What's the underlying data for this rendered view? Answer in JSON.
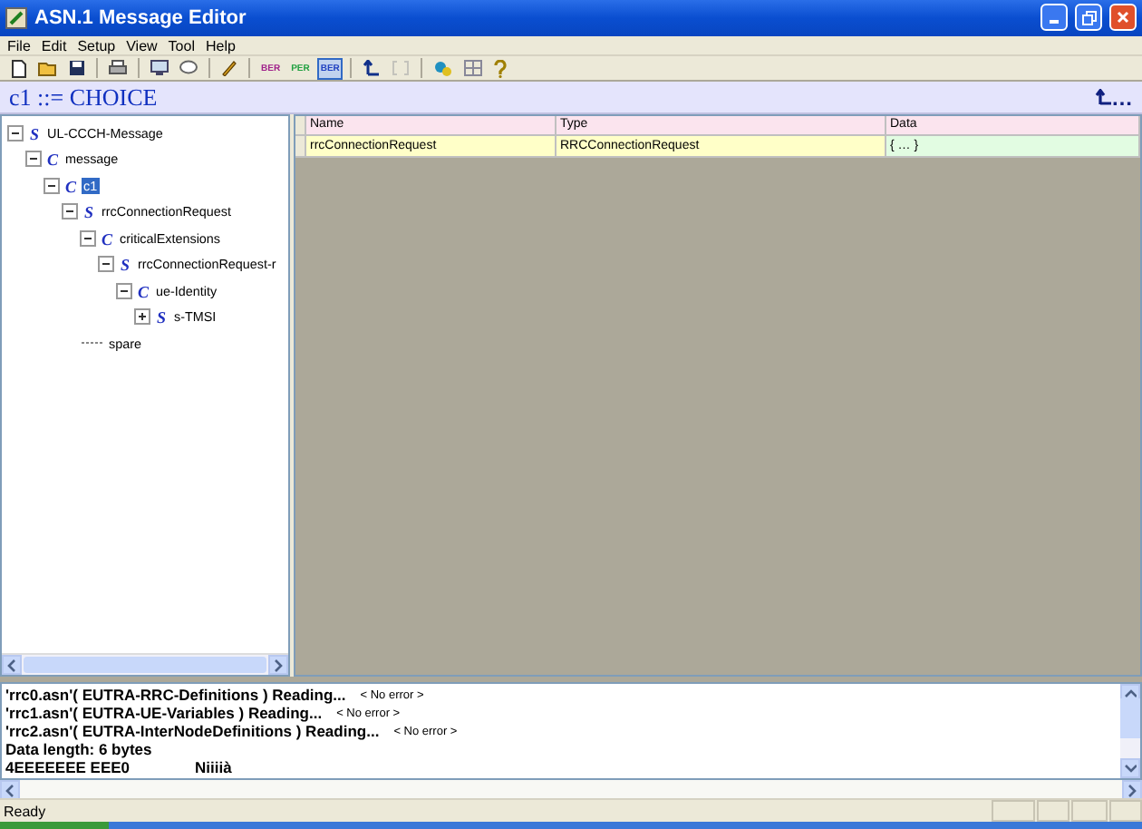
{
  "window": {
    "title": "ASN.1 Message Editor"
  },
  "menu": [
    "File",
    "Edit",
    "Setup",
    "View",
    "Tool",
    "Help"
  ],
  "toolbar": [
    {
      "kind": "new"
    },
    {
      "kind": "open"
    },
    {
      "kind": "save"
    },
    {
      "kind": "sep"
    },
    {
      "kind": "print"
    },
    {
      "kind": "sep"
    },
    {
      "kind": "view"
    },
    {
      "kind": "comment"
    },
    {
      "kind": "sep"
    },
    {
      "kind": "pen"
    },
    {
      "kind": "sep"
    },
    {
      "kind": "text",
      "label": "BER",
      "color": "#a0208a",
      "selected": false
    },
    {
      "kind": "text",
      "label": "PER",
      "color": "#20a040",
      "selected": false
    },
    {
      "kind": "text",
      "label": "BER",
      "color": "#2040c0",
      "selected": true
    },
    {
      "kind": "sep"
    },
    {
      "kind": "up"
    },
    {
      "kind": "bracket",
      "disabled": true
    },
    {
      "kind": "sep"
    },
    {
      "kind": "link"
    },
    {
      "kind": "grid"
    },
    {
      "kind": "help"
    }
  ],
  "header": {
    "title": "c1 ::= CHOICE",
    "action": "…"
  },
  "tree": [
    {
      "kind": "S",
      "label": "UL-CCCH-Message",
      "expanded": true,
      "selected": false,
      "children": [
        {
          "kind": "C",
          "label": "message",
          "expanded": true,
          "selected": false,
          "children": [
            {
              "kind": "C",
              "label": "c1",
              "expanded": true,
              "selected": true,
              "children": [
                {
                  "kind": "S",
                  "label": "rrcConnectionRequest",
                  "expanded": true,
                  "selected": false,
                  "children": [
                    {
                      "kind": "C",
                      "label": "criticalExtensions",
                      "expanded": true,
                      "selected": false,
                      "children": [
                        {
                          "kind": "S",
                          "label": "rrcConnectionRequest-r",
                          "expanded": true,
                          "selected": false,
                          "children": [
                            {
                              "kind": "C",
                              "label": "ue-Identity",
                              "expanded": true,
                              "selected": false,
                              "children": [
                                {
                                  "kind": "S",
                                  "label": "s-TMSI",
                                  "expanded": false,
                                  "selected": false
                                }
                              ]
                            }
                          ]
                        }
                      ]
                    }
                  ]
                },
                {
                  "kind": "N",
                  "label": "spare"
                }
              ]
            }
          ]
        }
      ]
    }
  ],
  "table": {
    "columns": [
      "Name",
      "Type",
      "Data"
    ],
    "rows": [
      [
        "rrcConnectionRequest",
        "RRCConnectionRequest",
        "{ … }"
      ]
    ]
  },
  "log": [
    {
      "text": "'rrc0.asn'( EUTRA-RRC-Definitions ) Reading...",
      "status": "< No error >"
    },
    {
      "text": "'rrc1.asn'( EUTRA-UE-Variables ) Reading...",
      "status": "< No error >"
    },
    {
      "text": "'rrc2.asn'( EUTRA-InterNodeDefinitions ) Reading...",
      "status": "< No error >"
    },
    {
      "text": "Data length: 6 bytes"
    },
    {
      "text": "4EEEEEEE EEE0",
      "status": "Niiiià",
      "kind": "hex"
    }
  ],
  "status_bar": {
    "text": "Ready"
  }
}
